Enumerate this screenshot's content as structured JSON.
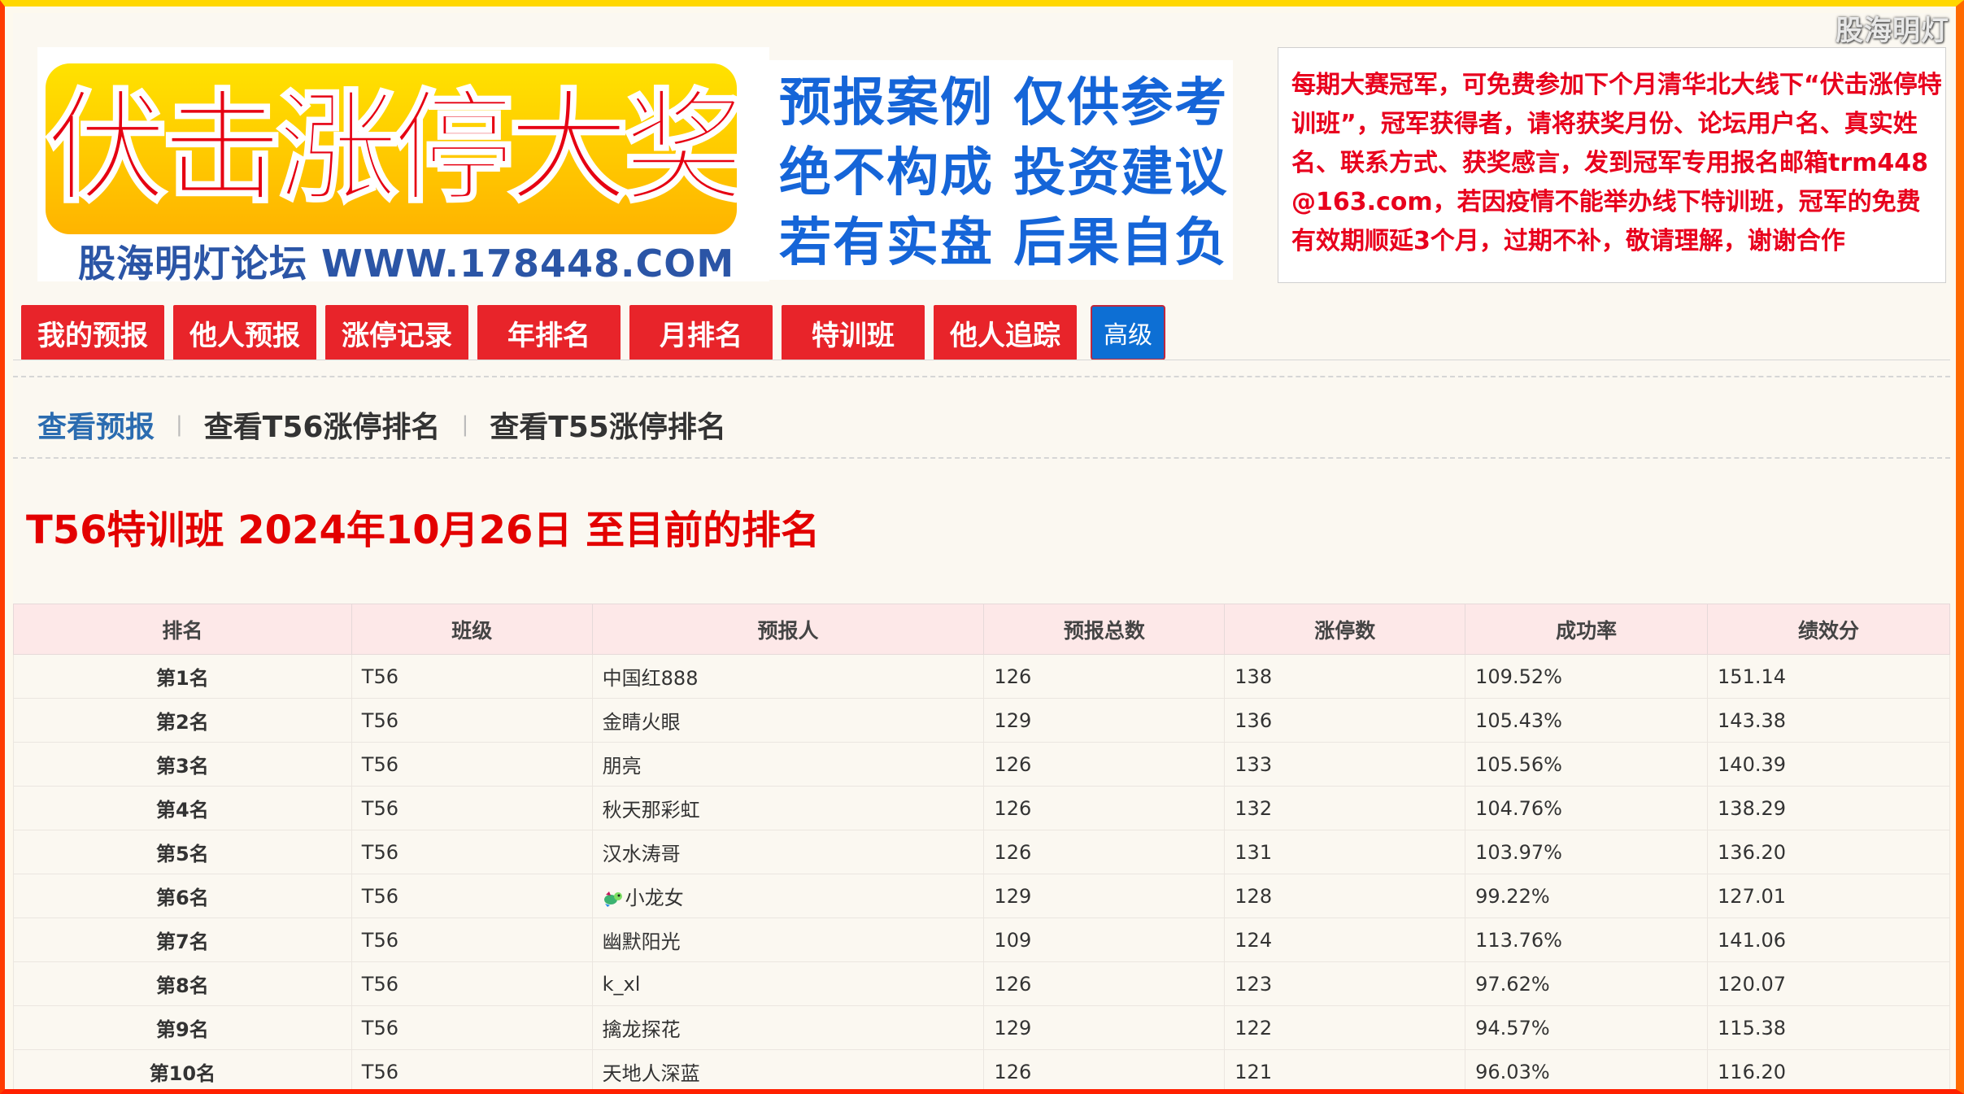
{
  "watermark": "股海明灯",
  "banner": {
    "title": "伏击涨停大奖赛",
    "subtitle": "股海明灯论坛 WWW.178448.COM"
  },
  "disclaimer": {
    "lines": [
      "预报案例 仅供参考",
      "绝不构成 投资建议",
      "若有实盘 后果自负"
    ]
  },
  "notice": {
    "text": "每期大赛冠军，可免费参加下个月清华北大线下“伏击涨停特训班”，冠军获得者，请将获奖月份、论坛用户名、真实姓名、联系方式、获奖感言，发到冠军专用报名邮箱trm448@163.com，若因疫情不能举办线下特训班，冠军的免费有效期顺延3个月，过期不补，敬请理解，谢谢合作"
  },
  "nav": {
    "items": [
      "我的预报",
      "他人预报",
      "涨停记录",
      "年排名",
      "月排名",
      "特训班",
      "他人追踪"
    ],
    "advanced": "高级"
  },
  "subnav": {
    "items": [
      "查看预报",
      "查看T56涨停排名",
      "查看T55涨停排名"
    ]
  },
  "page_title": "T56特训班 2024年10月26日 至目前的排名",
  "table": {
    "headers": [
      "排名",
      "班级",
      "预报人",
      "预报总数",
      "涨停数",
      "成功率",
      "绩效分"
    ],
    "rows": [
      [
        "第1名",
        "T56",
        "中国红888",
        "126",
        "138",
        "109.52%",
        "151.14"
      ],
      [
        "第2名",
        "T56",
        "金睛火眼",
        "129",
        "136",
        "105.43%",
        "143.38"
      ],
      [
        "第3名",
        "T56",
        "朋亮",
        "126",
        "133",
        "105.56%",
        "140.39"
      ],
      [
        "第4名",
        "T56",
        "秋天那彩虹",
        "126",
        "132",
        "104.76%",
        "138.29"
      ],
      [
        "第5名",
        "T56",
        "汉水涛哥",
        "126",
        "131",
        "103.97%",
        "136.20"
      ],
      [
        "第6名",
        "T56",
        "小龙女",
        "129",
        "128",
        "99.22%",
        "127.01"
      ],
      [
        "第7名",
        "T56",
        "幽默阳光",
        "109",
        "124",
        "113.76%",
        "141.06"
      ],
      [
        "第8名",
        "T56",
        "k_xl",
        "126",
        "123",
        "97.62%",
        "120.07"
      ],
      [
        "第9名",
        "T56",
        "擒龙探花",
        "129",
        "122",
        "94.57%",
        "115.38"
      ],
      [
        "第10名",
        "T56",
        "天地人深蓝",
        "126",
        "121",
        "96.03%",
        "116.20"
      ]
    ]
  }
}
